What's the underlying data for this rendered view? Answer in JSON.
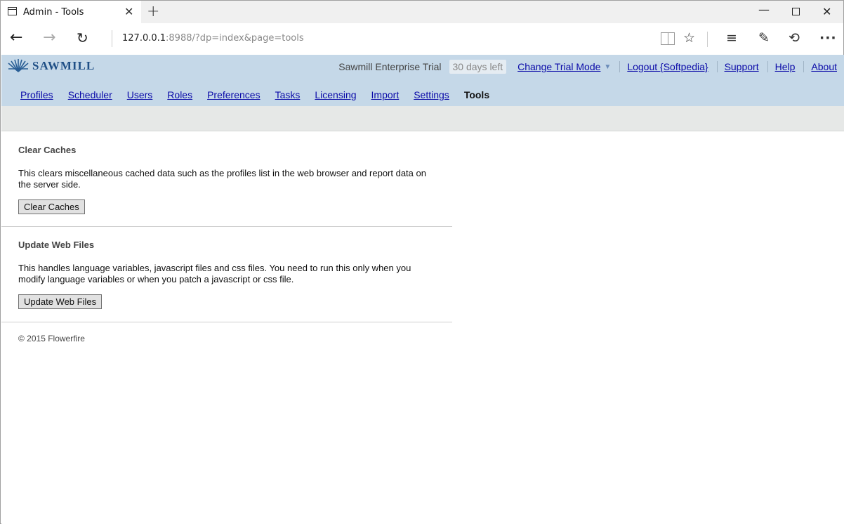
{
  "browser": {
    "tab_title": "Admin - Tools",
    "url_host": "127.0.0.1",
    "url_rest": ":8988/?dp=index&page=tools"
  },
  "header": {
    "logo_text": "SAWMILL",
    "product": "Sawmill Enterprise Trial",
    "trial_badge": "30 days left",
    "links": {
      "change_trial_mode": "Change Trial Mode",
      "logout": "Logout {Softpedia}",
      "support": "Support",
      "help": "Help",
      "about": "About"
    }
  },
  "nav": {
    "items": [
      "Profiles",
      "Scheduler",
      "Users",
      "Roles",
      "Preferences",
      "Tasks",
      "Licensing",
      "Import",
      "Settings"
    ],
    "active": "Tools"
  },
  "sections": {
    "clear_caches": {
      "title": "Clear Caches",
      "text": "This clears miscellaneous cached data such as the profiles list in the web browser and report data on the server side.",
      "button": "Clear Caches"
    },
    "update_web_files": {
      "title": "Update Web Files",
      "text": "This handles language variables, javascript files and css files. You need to run this only when you modify language variables or when you patch a javascript or css file.",
      "button": "Update Web Files"
    }
  },
  "footer": "© 2015 Flowerfire",
  "colors": {
    "header_bg": "#c5d8e8",
    "link": "#0a0aa8",
    "logo": "#1f4f86"
  }
}
